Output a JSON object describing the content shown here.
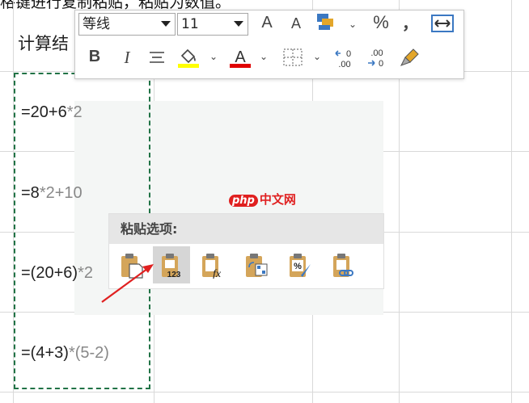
{
  "caption": "格键进行复制粘贴，粘贴为数值。",
  "sheet": {
    "header": "计算结",
    "formulas": [
      {
        "main": "=20+6",
        "tail": "*2"
      },
      {
        "main": "=8",
        "tail": "*2+10"
      },
      {
        "main": "=(20+6)",
        "tail": "*2"
      },
      {
        "main": "=(4+3)",
        "tail": "*(5-2)"
      }
    ]
  },
  "toolbar": {
    "font_name": "等线",
    "font_size": "11",
    "grow_font": "A",
    "shrink_font": "A",
    "percent": "%",
    "comma": "，",
    "bold": "B",
    "italic": "I",
    "fill_color": "#ffff00",
    "font_color": "#e00000",
    "increase_decimal_label": "←0\n.00",
    "decrease_decimal_label": ".00\n→0"
  },
  "paste_options": {
    "title": "粘贴选项:",
    "badge": "123",
    "fx": "fx"
  },
  "watermark": {
    "badge": "php",
    "text": "中文网"
  }
}
